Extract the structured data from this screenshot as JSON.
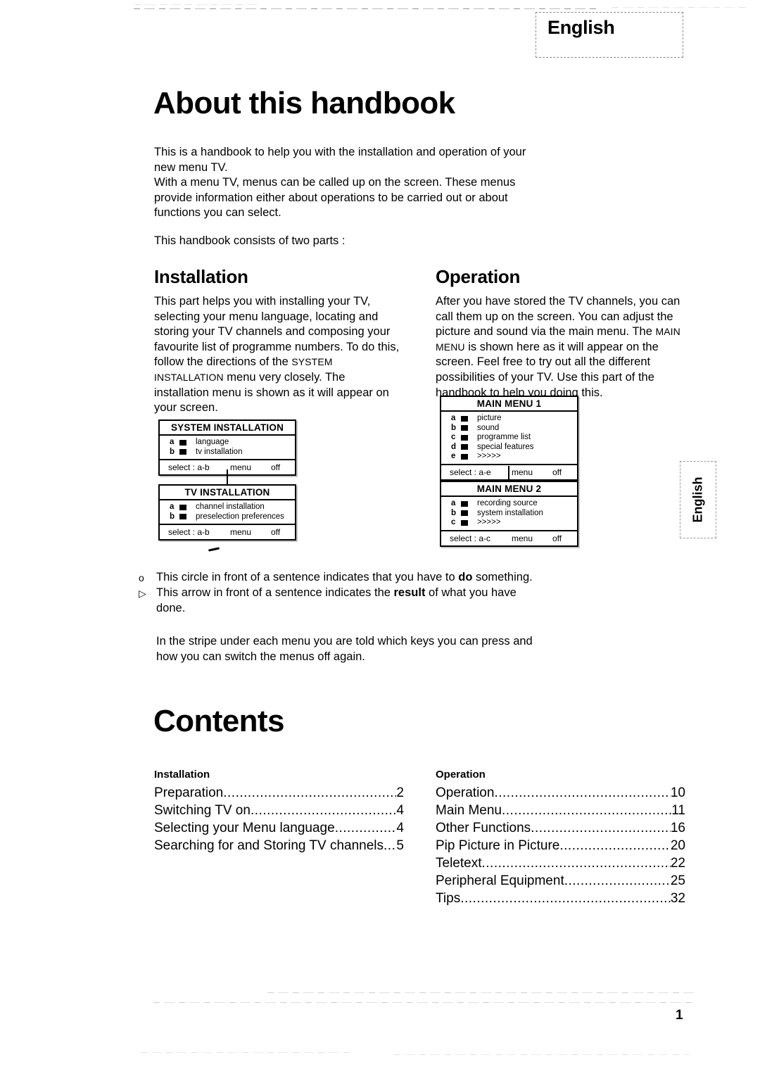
{
  "header": {
    "language_tab": "English",
    "side_tab": "English"
  },
  "page_title": "About this handbook",
  "intro": {
    "paragraph1": "This is a handbook to help you with the installation and operation of your new menu TV.\nWith a menu TV, menus can be called up on the screen. These menus provide information either about operations to be carried out or about functions you can select.",
    "paragraph2": "This handbook consists of two parts :"
  },
  "columns": {
    "installation": {
      "heading": "Installation",
      "body_part1": "This part helps you with installing your TV, selecting your menu language, locating and storing your TV channels and composing your favourite list of programme numbers. To do this, follow the directions of the ",
      "body_smallcaps": "SYSTEM INSTALLATION",
      "body_part2": " menu very closely. The installation menu is shown as it will appear on your screen."
    },
    "operation": {
      "heading": "Operation",
      "body_part1": "After you have stored the TV channels, you can call them up on the screen. You can adjust the picture and sound via the main menu. The ",
      "body_smallcaps": "MAIN MENU",
      "body_part2": " is shown here as it will appear on the screen. Feel free to try out all the different possibilities of your TV. Use this part of the handbook to help you doing this."
    }
  },
  "menus": {
    "system_installation": {
      "title": "SYSTEM INSTALLATION",
      "rows": [
        {
          "key": "a",
          "label": "language"
        },
        {
          "key": "b",
          "label": "tv installation"
        }
      ],
      "footer": {
        "select": "select : a-b",
        "menu": "menu",
        "off": "off"
      }
    },
    "tv_installation": {
      "title": "TV INSTALLATION",
      "rows": [
        {
          "key": "a",
          "label": "channel installation"
        },
        {
          "key": "b",
          "label": "preselection preferences"
        }
      ],
      "footer": {
        "select": "select : a-b",
        "menu": "menu",
        "off": "off"
      }
    },
    "main_menu_1": {
      "title": "MAIN MENU 1",
      "rows": [
        {
          "key": "a",
          "label": "picture"
        },
        {
          "key": "b",
          "label": "sound"
        },
        {
          "key": "c",
          "label": "programme list"
        },
        {
          "key": "d",
          "label": "special features"
        },
        {
          "key": "e",
          "label": ">>>>>"
        }
      ],
      "footer": {
        "select": "select : a-e",
        "menu": "menu",
        "off": "off"
      }
    },
    "main_menu_2": {
      "title": "MAIN MENU 2",
      "rows": [
        {
          "key": "a",
          "label": "recording source"
        },
        {
          "key": "b",
          "label": "system installation"
        },
        {
          "key": "c",
          "label": ">>>>>"
        }
      ],
      "footer": {
        "select": "select : a-c",
        "menu": "menu",
        "off": "off"
      }
    }
  },
  "legend": {
    "circle_mark": "o",
    "circle_text_before": "This circle in front of a sentence indicates that you have to ",
    "circle_text_bold": "do",
    "circle_text_after": " something.",
    "arrow_mark": "▷",
    "arrow_text_before": "This arrow in front of a sentence indicates the ",
    "arrow_text_bold": "result",
    "arrow_text_after": " of what you have done.",
    "note": "In the stripe under each menu you are told which keys you can press and how you can switch the menus off again."
  },
  "contents": {
    "title": "Contents",
    "installation": {
      "heading": "Installation",
      "entries": [
        {
          "label": "Preparation",
          "page": "2"
        },
        {
          "label": "Switching TV on",
          "page": "4"
        },
        {
          "label": "Selecting your Menu language",
          "page": "4"
        },
        {
          "label": "Searching for and Storing TV channels ",
          "page": "5"
        }
      ]
    },
    "operation": {
      "heading": "Operation",
      "entries": [
        {
          "label": "Operation",
          "page": "10"
        },
        {
          "label": "Main Menu ",
          "page": "11"
        },
        {
          "label": "Other Functions",
          "page": "16"
        },
        {
          "label": "Pip Picture in Picture",
          "page": "20"
        },
        {
          "label": "Teletext ",
          "page": "22"
        },
        {
          "label": "Peripheral Equipment",
          "page": "25"
        },
        {
          "label": "Tips",
          "page": "32"
        }
      ]
    }
  },
  "footer": {
    "page_number": "1"
  }
}
